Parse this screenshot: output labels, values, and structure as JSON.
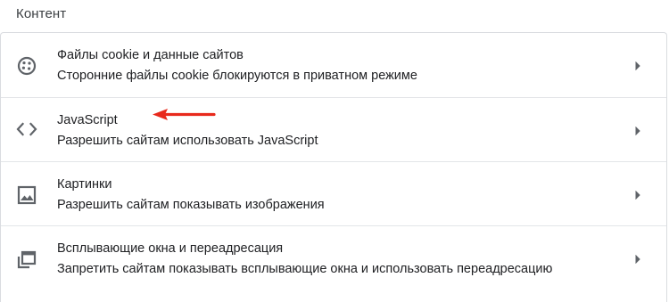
{
  "section": {
    "title": "Контент"
  },
  "items": [
    {
      "title": "Файлы cookie и данные сайтов",
      "subtitle": "Сторонние файлы cookie блокируются в приватном режиме",
      "icon": "cookie-icon"
    },
    {
      "title": "JavaScript",
      "subtitle": "Разрешить сайтам использовать JavaScript",
      "icon": "code-icon"
    },
    {
      "title": "Картинки",
      "subtitle": "Разрешить сайтам показывать изображения",
      "icon": "image-icon"
    },
    {
      "title": "Всплывающие окна и переадресация",
      "subtitle": "Запретить сайтам показывать всплывающие окна и использовать переадресацию",
      "icon": "popup-icon"
    }
  ],
  "colors": {
    "text": "#202124",
    "icon": "#5f6368",
    "annotation_arrow": "#e8291c",
    "divider": "#e3e5e8"
  }
}
